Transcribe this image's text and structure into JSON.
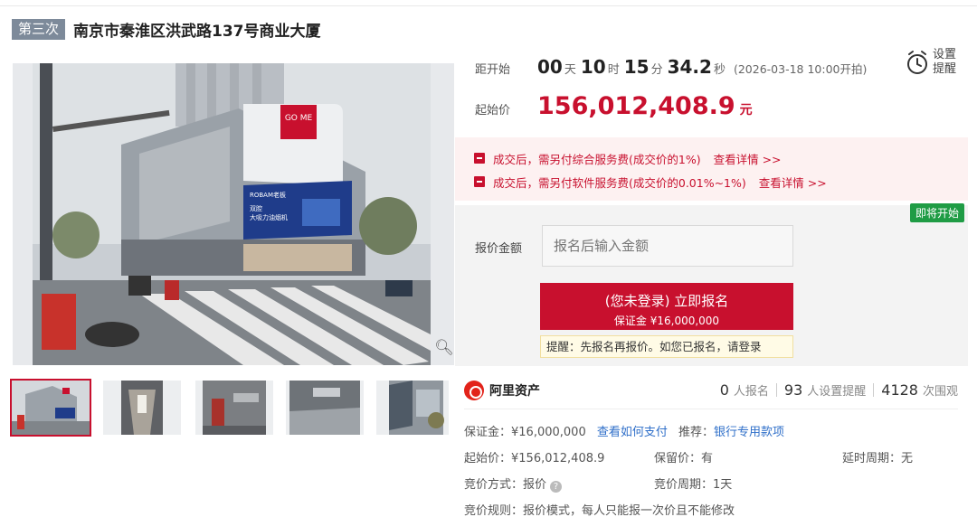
{
  "header": {
    "round_badge": "第三次",
    "title": "南京市秦淮区洪武路137号商业大厦"
  },
  "gallery": {
    "zoom_icon": "zoom-icon",
    "building_logo": "GO ME",
    "billboard_brand": "ROBAM老板",
    "billboard_line1": "双腔",
    "billboard_line2": "大吸力油烟机",
    "thumbnail_count": 5,
    "active_thumbnail_index": 0
  },
  "countdown": {
    "label": "距开始",
    "days": "00",
    "days_unit": "天",
    "hours": "10",
    "hours_unit": "时",
    "minutes": "15",
    "minutes_unit": "分",
    "seconds": "34.2",
    "seconds_unit": "秒",
    "start_text": "(2026-03-18 10:00开拍)"
  },
  "reminder": {
    "icon": "alarm-clock-icon",
    "line1": "设置",
    "line2": "提醒"
  },
  "price": {
    "label": "起始价",
    "value": "156,012,408.9",
    "unit": "元"
  },
  "fees": [
    {
      "text": "成交后，需另付综合服务费(成交价的1%)",
      "link": "查看详情 >>"
    },
    {
      "text": "成交后，需另付软件服务费(成交价的0.01%~1%)",
      "link": "查看详情 >>"
    }
  ],
  "bid": {
    "status_badge": "即将开始",
    "label": "报价金额",
    "input_placeholder": "报名后输入金额",
    "button_main": "(您未登录) 立即报名",
    "button_sub": "保证金 ¥16,000,000",
    "tip": "提醒：先报名再报价。如您已报名，请登录"
  },
  "platform": {
    "name": "阿里资产",
    "stats": [
      {
        "num": "0",
        "label": "人报名"
      },
      {
        "num": "93",
        "label": "人设置提醒"
      },
      {
        "num": "4128",
        "label": "次围观"
      }
    ]
  },
  "details": {
    "deposit_label": "保证金：",
    "deposit_value": "¥16,000,000",
    "pay_link": "查看如何支付",
    "recommend_label": "推荐：",
    "recommend_link": "银行专用款项",
    "start_price_label": "起始价：",
    "start_price_value": "¥156,012,408.9",
    "reserve_label": "保留价：",
    "reserve_value": "有",
    "extend_label": "延时周期：",
    "extend_value": "无",
    "bid_mode_label": "竞价方式：",
    "bid_mode_value": "报价",
    "bid_cycle_label": "竞价周期：",
    "bid_cycle_value": "1天",
    "rule_label": "竞价规则：",
    "rule_value": "报价模式，每人只能报一次价且不能修改"
  },
  "colors": {
    "accent": "#c8102e",
    "status_green": "#1f9c45",
    "link": "#2f6fc9",
    "badge_gray": "#7d8a9a"
  }
}
